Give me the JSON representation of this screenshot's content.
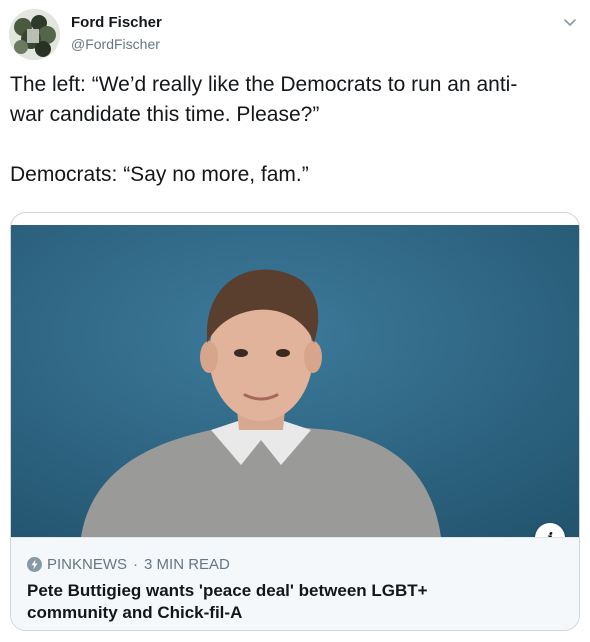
{
  "author": {
    "name": "Ford Fischer",
    "handle": "@FordFischer",
    "avatar_icon": "avatar-photo"
  },
  "tweet": {
    "line1": "The left: “We’d really like the Democrats to run an anti-",
    "line2": "war candidate this time. Please?”",
    "line3": "Democrats: “Say no more, fam.”"
  },
  "card": {
    "source": "PINKNEWS",
    "separator": "·",
    "read_time": "3 MIN READ",
    "headline_line1": "Pete Buttigieg wants 'peace deal' between LGBT+",
    "headline_line2": "community and Chick-fil-A",
    "info_label": "i",
    "image_bg_color": "#2f6786"
  },
  "colors": {
    "text_primary": "#14171a",
    "text_secondary": "#657786",
    "border": "#ccd6dd",
    "card_meta_bg": "#f5f8fa"
  }
}
